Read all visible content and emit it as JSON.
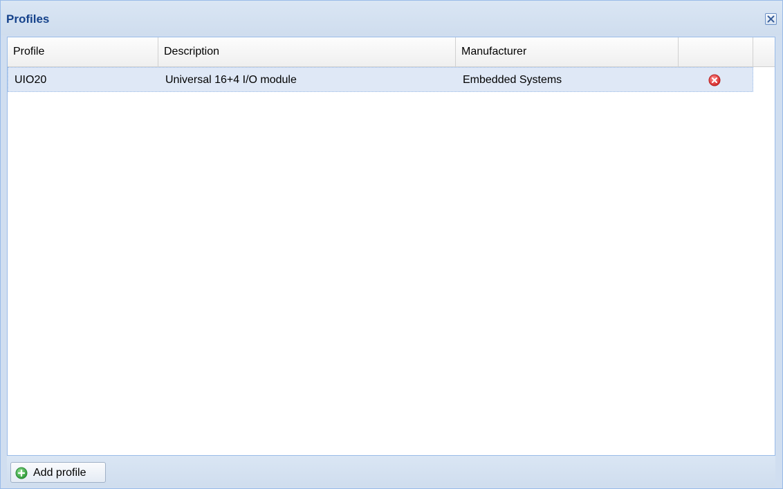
{
  "window": {
    "title": "Profiles"
  },
  "grid": {
    "columns": [
      {
        "label": "Profile"
      },
      {
        "label": "Description"
      },
      {
        "label": "Manufacturer"
      },
      {
        "label": ""
      }
    ],
    "rows": [
      {
        "profile": "UIO20",
        "description": "Universal 16+4 I/O module",
        "manufacturer": "Embedded Systems",
        "action_icon": "delete-icon",
        "selected": true
      }
    ]
  },
  "toolbar": {
    "add_label": "Add profile",
    "add_icon": "add-icon"
  },
  "colors": {
    "title_text": "#15428b",
    "panel_bg": "#d0def0",
    "border": "#99bbe8",
    "selected_row": "#dfe8f6",
    "delete_red": "#e0323a",
    "add_green": "#3fa94a"
  }
}
